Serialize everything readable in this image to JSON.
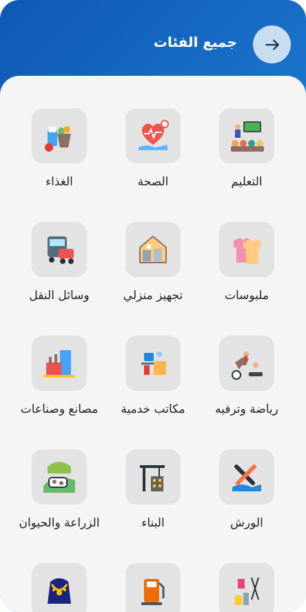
{
  "header": {
    "title": "جميع الفئات",
    "back_icon": "arrow-right-icon"
  },
  "categories": [
    {
      "label": "التعليم",
      "icon": "education-icon"
    },
    {
      "label": "الصحة",
      "icon": "health-icon"
    },
    {
      "label": "الغذاء",
      "icon": "food-icon"
    },
    {
      "label": "ملبوسات",
      "icon": "clothes-icon"
    },
    {
      "label": "تجهيز منزلي",
      "icon": "home-equipment-icon"
    },
    {
      "label": "وسائل النقل",
      "icon": "transport-icon"
    },
    {
      "label": "رياضة وترفيه",
      "icon": "sports-icon"
    },
    {
      "label": "مكاتب خدمية",
      "icon": "office-icon"
    },
    {
      "label": "مصانع وصناعات",
      "icon": "factory-icon"
    },
    {
      "label": "الورش",
      "icon": "workshop-icon"
    },
    {
      "label": "البناء",
      "icon": "construction-icon"
    },
    {
      "label": "الزراعة والحيوان",
      "icon": "farm-icon"
    },
    {
      "label": "",
      "icon": "beauty-icon"
    },
    {
      "label": "",
      "icon": "fuel-station-icon"
    },
    {
      "label": "",
      "icon": "jewelry-icon"
    }
  ]
}
